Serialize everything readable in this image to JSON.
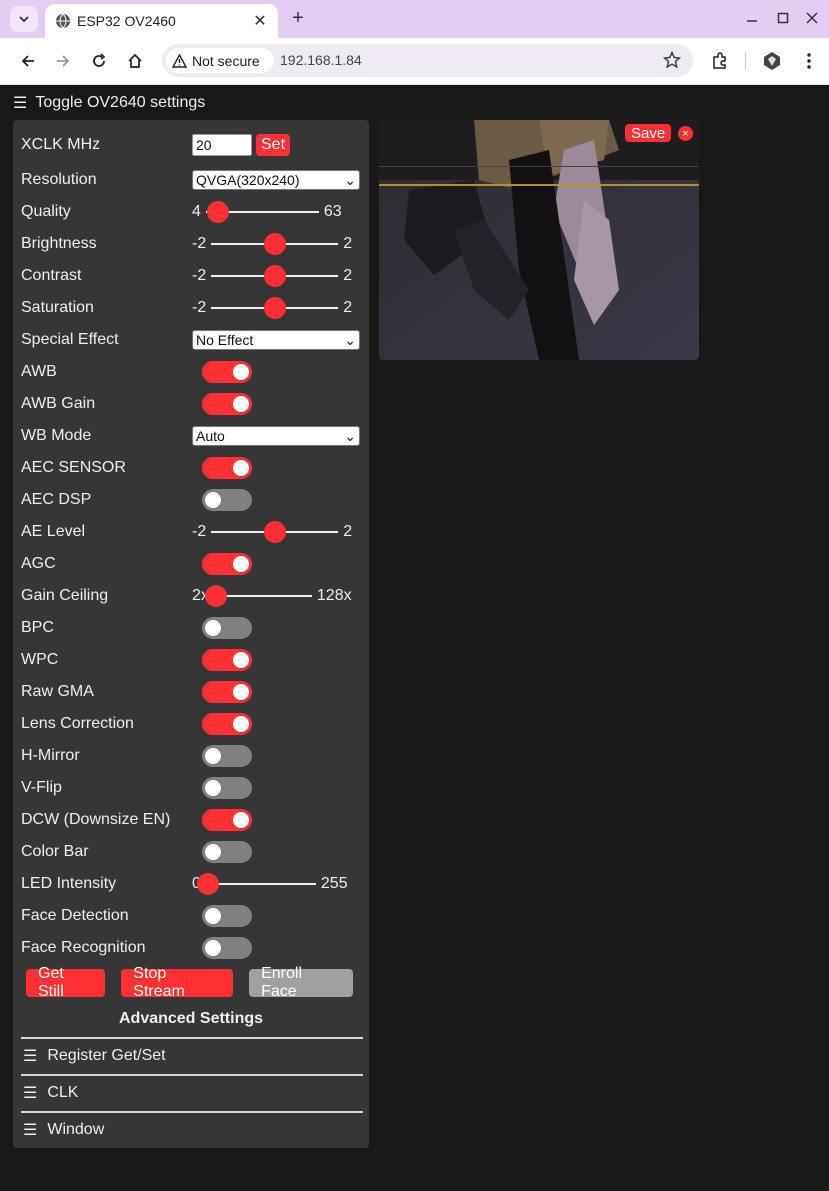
{
  "browser": {
    "tab_title": "ESP32 OV2460",
    "security_label": "Not secure",
    "url": "192.168.1.84"
  },
  "page": {
    "toggle_settings": "Toggle OV2640 settings",
    "menu_glyph": "☰",
    "xclk": {
      "label": "XCLK MHz",
      "value": "20",
      "set_label": "Set"
    },
    "resolution": {
      "label": "Resolution",
      "selected": "QVGA(320x240)"
    },
    "quality": {
      "label": "Quality",
      "min": "4",
      "max": "63",
      "value": 10
    },
    "brightness": {
      "label": "Brightness",
      "min": "-2",
      "max": "2",
      "value": 0
    },
    "contrast": {
      "label": "Contrast",
      "min": "-2",
      "max": "2",
      "value": 0
    },
    "saturation": {
      "label": "Saturation",
      "min": "-2",
      "max": "2",
      "value": 0
    },
    "special_effect": {
      "label": "Special Effect",
      "selected": "No Effect"
    },
    "awb": {
      "label": "AWB",
      "on": true
    },
    "awb_gain": {
      "label": "AWB Gain",
      "on": true
    },
    "wb_mode": {
      "label": "WB Mode",
      "selected": "Auto"
    },
    "aec_sensor": {
      "label": "AEC SENSOR",
      "on": true
    },
    "aec_dsp": {
      "label": "AEC DSP",
      "on": false
    },
    "ae_level": {
      "label": "AE Level",
      "min": "-2",
      "max": "2",
      "value": 0
    },
    "agc": {
      "label": "AGC",
      "on": true
    },
    "gain_ceiling": {
      "label": "Gain Ceiling",
      "min": "2x",
      "max": "128x",
      "value": 0
    },
    "bpc": {
      "label": "BPC",
      "on": false
    },
    "wpc": {
      "label": "WPC",
      "on": true
    },
    "raw_gma": {
      "label": "Raw GMA",
      "on": true
    },
    "lens_correction": {
      "label": "Lens Correction",
      "on": true
    },
    "h_mirror": {
      "label": "H-Mirror",
      "on": false
    },
    "v_flip": {
      "label": "V-Flip",
      "on": false
    },
    "dcw": {
      "label": "DCW (Downsize EN)",
      "on": true
    },
    "color_bar": {
      "label": "Color Bar",
      "on": false
    },
    "led_intensity": {
      "label": "LED Intensity",
      "min": "0",
      "max": "255",
      "value": 0
    },
    "face_detection": {
      "label": "Face Detection",
      "on": false
    },
    "face_recognition": {
      "label": "Face Recognition",
      "on": false
    },
    "buttons": {
      "get_still": "Get Still",
      "stop_stream": "Stop Stream",
      "enroll_face": "Enroll Face"
    },
    "advanced_title": "Advanced Settings",
    "advanced_sections": [
      "Register Get/Set",
      "CLK",
      "Window"
    ],
    "viewer": {
      "save_label": "Save",
      "close_label": "×"
    }
  },
  "colors": {
    "accent": "#ff3034",
    "panel": "#363636",
    "background": "#181818"
  }
}
